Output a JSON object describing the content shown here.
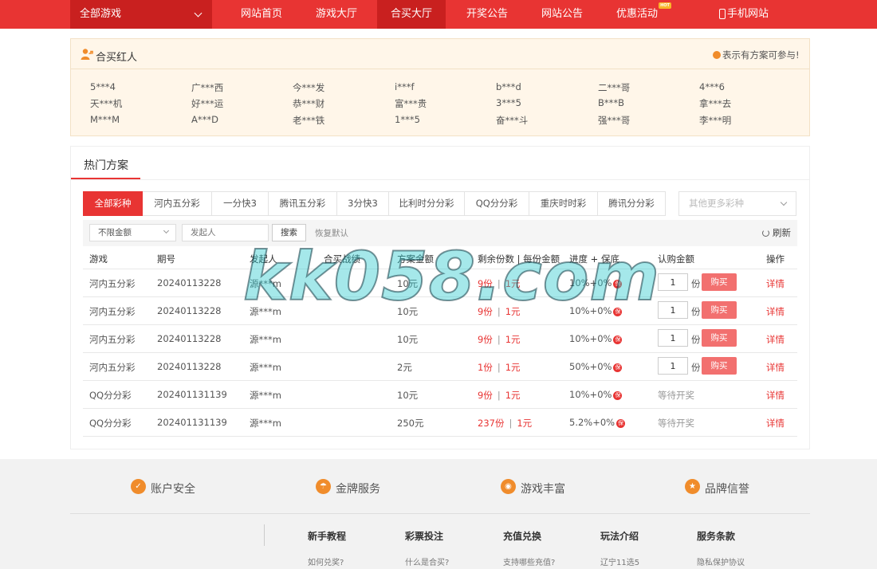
{
  "nav": {
    "all_games": "全部游戏",
    "items": [
      "网站首页",
      "游戏大厅",
      "合买大厅",
      "开奖公告",
      "网站公告",
      "优惠活动",
      "手机网站"
    ],
    "active_index": 2,
    "hot_badge": "HOT"
  },
  "hongren": {
    "title": "合买红人",
    "tip": "表示有方案可参与!",
    "names": [
      [
        "5***4",
        "广***西",
        "今***发",
        "i***f",
        "b***d",
        "二***哥",
        "4***6"
      ],
      [
        "天***机",
        "好***运",
        "恭***财",
        "富***贵",
        "3***5",
        "B***B",
        "拿***去"
      ],
      [
        "M***M",
        "A***D",
        "老***铁",
        "1***5",
        "奋***斗",
        "强***哥",
        "李***明"
      ]
    ]
  },
  "hot": {
    "title": "热门方案",
    "lottery_tabs": [
      "全部彩种",
      "河内五分彩",
      "一分快3",
      "腾讯五分彩",
      "3分快3",
      "比利时分分彩",
      "QQ分分彩",
      "重庆时时彩",
      "腾讯分分彩"
    ],
    "more_placeholder": "其他更多彩种",
    "filter": {
      "amount_select": "不限金额",
      "initiator_placeholder": "发起人",
      "search_label": "搜索",
      "reset_label": "恢复默认",
      "refresh_label": "刷新"
    },
    "columns": [
      "游戏",
      "期号",
      "发起人",
      "合买战绩",
      "方案金额",
      "剩余份数 | 每份金额",
      "进度 + 保底",
      "认购金额",
      "操作"
    ],
    "rows": [
      {
        "game": "河内五分彩",
        "issue": "20240113228",
        "initiator": "源***m",
        "record": "",
        "amount": "10元",
        "remain": "9份",
        "per": "1元",
        "progress": "10%+0%",
        "qty": "1",
        "fen": "份",
        "action": "购买",
        "detail": "详情"
      },
      {
        "game": "河内五分彩",
        "issue": "20240113228",
        "initiator": "源***m",
        "record": "",
        "amount": "10元",
        "remain": "9份",
        "per": "1元",
        "progress": "10%+0%",
        "qty": "1",
        "fen": "份",
        "action": "购买",
        "detail": "详情"
      },
      {
        "game": "河内五分彩",
        "issue": "20240113228",
        "initiator": "源***m",
        "record": "",
        "amount": "10元",
        "remain": "9份",
        "per": "1元",
        "progress": "10%+0%",
        "qty": "1",
        "fen": "份",
        "action": "购买",
        "detail": "详情"
      },
      {
        "game": "河内五分彩",
        "issue": "20240113228",
        "initiator": "源***m",
        "record": "",
        "amount": "2元",
        "remain": "1份",
        "per": "1元",
        "progress": "50%+0%",
        "qty": "1",
        "fen": "份",
        "action": "购买",
        "detail": "详情"
      },
      {
        "game": "QQ分分彩",
        "issue": "202401131139",
        "initiator": "源***m",
        "record": "",
        "amount": "10元",
        "remain": "9份",
        "per": "1元",
        "progress": "10%+0%",
        "status": "等待开奖",
        "detail": "详情"
      },
      {
        "game": "QQ分分彩",
        "issue": "202401131139",
        "initiator": "源***m",
        "record": "",
        "amount": "250元",
        "remain": "237份",
        "per": "1元",
        "progress": "5.2%+0%",
        "status": "等待开奖",
        "detail": "详情"
      }
    ],
    "bao_label": "保"
  },
  "watermark": "kk058.com",
  "footer": {
    "features": [
      {
        "label": "账户安全",
        "icon": "shield-icon"
      },
      {
        "label": "金牌服务",
        "icon": "umbrella-icon"
      },
      {
        "label": "游戏丰富",
        "icon": "gamepad-icon"
      },
      {
        "label": "品牌信誉",
        "icon": "medal-icon"
      }
    ],
    "columns": [
      {
        "title": "新手教程",
        "link": "如何兑奖?"
      },
      {
        "title": "彩票投注",
        "link": "什么是合买?"
      },
      {
        "title": "充值兑换",
        "link": "支持哪些充值?"
      },
      {
        "title": "玩法介绍",
        "link": "辽宁11选5"
      },
      {
        "title": "服务条款",
        "link": "隐私保护协议"
      }
    ]
  },
  "colors": {
    "brand_red": "#e83433",
    "dark_red": "#c9201f",
    "panel_cream": "#fff6e9",
    "accent_orange": "#f08c2b"
  }
}
